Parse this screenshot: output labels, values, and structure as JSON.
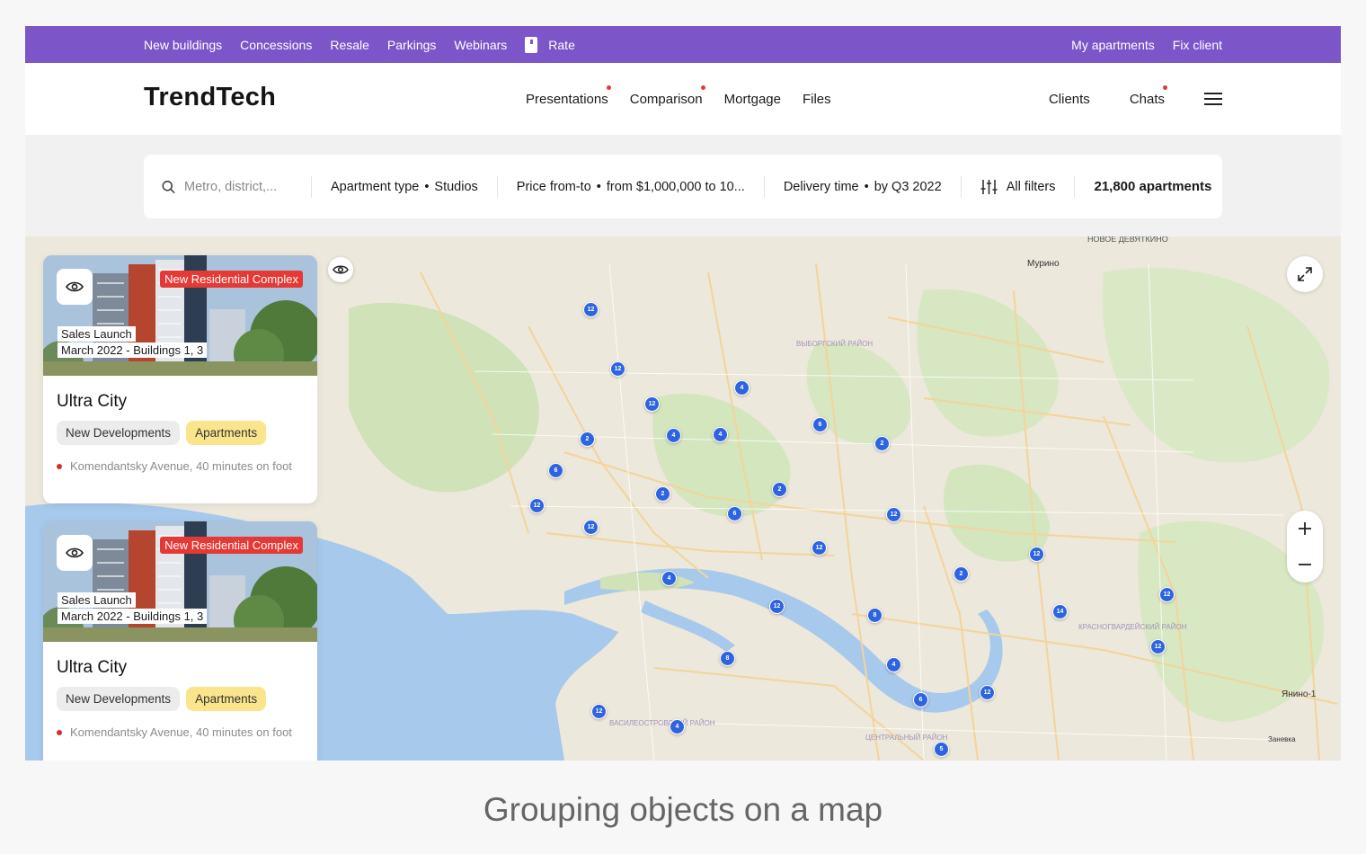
{
  "topbar": {
    "left_links": [
      "New buildings",
      "Concessions",
      "Resale",
      "Parkings",
      "Webinars"
    ],
    "rate_label": "Rate",
    "right_links": [
      "My apartments",
      "Fix client"
    ]
  },
  "header": {
    "logo": "TrendTech",
    "nav": [
      "Presentations",
      "Comparison",
      "Mortgage",
      "Files"
    ],
    "clients": "Clients",
    "chats": "Chats"
  },
  "search": {
    "placeholder": "Metro, district,...",
    "apartment_type_label": "Apartment type",
    "apartment_type_value": "Studios",
    "price_label": "Price from-to",
    "price_value": "from $1,000,000 to 10...",
    "delivery_label": "Delivery time",
    "delivery_value": "by Q3 2022",
    "filters_label": "All filters",
    "count": "21,800 apartments"
  },
  "cards": [
    {
      "badge": "New Residential Complex",
      "sales_line1": "Sales Launch",
      "sales_line2": "March 2022 - Buildings 1, 3",
      "title": "Ultra City",
      "tag1": "New Developments",
      "tag2": "Apartments",
      "metro": "Komendantsky Avenue, 40 minutes on foot"
    },
    {
      "badge": "New Residential Complex",
      "sales_line1": "Sales Launch",
      "sales_line2": "March 2022 - Buildings 1, 3",
      "title": "Ultra City",
      "tag1": "New Developments",
      "tag2": "Apartments",
      "metro": "Komendantsky Avenue, 40 minutes on foot"
    }
  ],
  "map": {
    "labels": {
      "novoe": "НОВОЕ ДЕВЯТКИНО",
      "murino": "Мурино",
      "yanino": "Янино-1",
      "zanevka": "Заневка",
      "vyborg": "ВЫБОРГСКИЙ РАЙОН",
      "krasnogvard": "КРАСНОГВАРДЕЙСКИЙ РАЙОН",
      "vasileostr": "ВАСИЛЕОСТРОВСКИЙ РАЙОН",
      "central": "ЦЕНТРАЛЬНЫЙ РАЙОН"
    },
    "clusters": [
      "12",
      "12",
      "12",
      "4",
      "6",
      "2",
      "4",
      "4",
      "2",
      "6",
      "2",
      "12",
      "12",
      "6",
      "2",
      "12",
      "2",
      "12",
      "12",
      "4",
      "12",
      "12",
      "12",
      "8",
      "8",
      "4",
      "14",
      "12",
      "12",
      "4",
      "6",
      "5"
    ]
  },
  "caption": "Grouping objects on a map",
  "colors": {
    "purple": "#7c55c9",
    "cluster": "#2f64e0",
    "badge": "#e53935",
    "tag_yellow": "#fbe58c"
  }
}
